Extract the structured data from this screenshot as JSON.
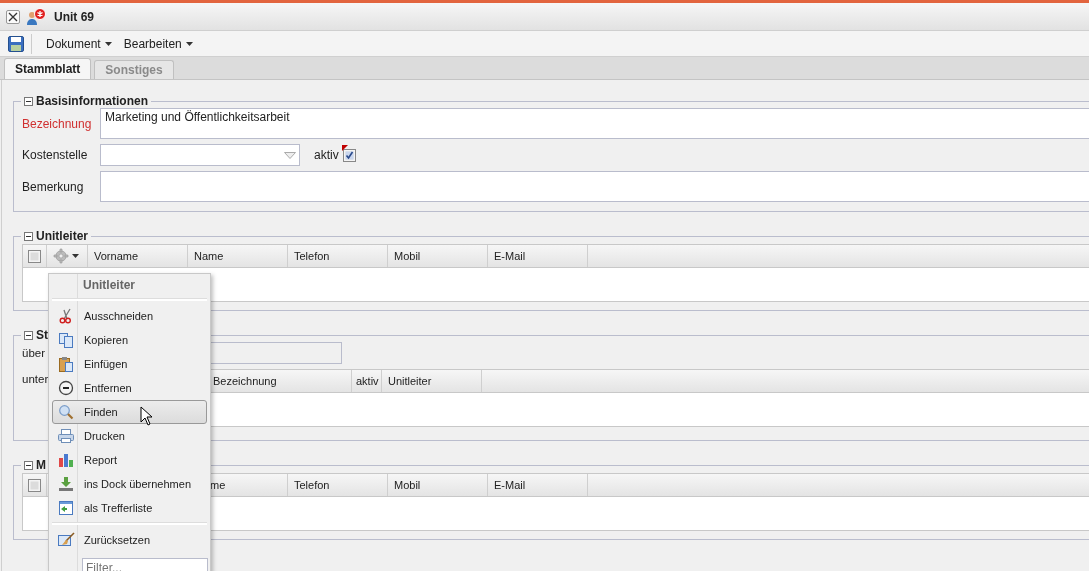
{
  "window": {
    "title": "Unit 69"
  },
  "toolbar": {
    "menus": [
      "Dokument",
      "Bearbeiten"
    ]
  },
  "tabs": [
    {
      "label": "Stammblatt",
      "selected": true
    },
    {
      "label": "Sonstiges",
      "selected": false
    }
  ],
  "basis": {
    "title": "Basisinformationen",
    "expanded": true,
    "bezeichnung": {
      "label": "Bezeichnung",
      "required": true,
      "value": "Marketing und Öffentlichkeitsarbeit"
    },
    "kostenstelle": {
      "label": "Kostenstelle"
    },
    "aktiv": {
      "label": "aktiv",
      "checked": true,
      "modified": true
    },
    "bemerkung": {
      "label": "Bemerkung"
    }
  },
  "unitleiter": {
    "title": "Unitleiter",
    "expanded": true,
    "select_all_checked": false,
    "columns": [
      "Vorname",
      "Name",
      "Telefon",
      "Mobil",
      "E-Mail"
    ]
  },
  "section_3": {
    "title": "St",
    "expanded": true,
    "field_label": "über",
    "grid_label": "unter",
    "columns": [
      "Bezeichnung",
      "aktiv",
      "Unitleiter"
    ]
  },
  "section_4": {
    "title": "M",
    "expanded": true,
    "select_all_checked": false,
    "columns": [
      "me",
      "Telefon",
      "Mobil",
      "E-Mail"
    ]
  },
  "context_menu": {
    "title": "Unitleiter",
    "groups": [
      [
        {
          "label": "Ausschneiden",
          "kind": "cut",
          "selected": false
        },
        {
          "label": "Kopieren",
          "kind": "copy",
          "selected": false
        },
        {
          "label": "Einfügen",
          "kind": "paste",
          "selected": false
        },
        {
          "label": "Entfernen",
          "kind": "remove",
          "selected": false
        },
        {
          "label": "Finden",
          "kind": "find",
          "selected": true
        },
        {
          "label": "Drucken",
          "kind": "print",
          "selected": false
        },
        {
          "label": "Report",
          "kind": "report",
          "selected": false
        },
        {
          "label": "ins Dock übernehmen",
          "kind": "dock",
          "selected": false
        },
        {
          "label": "als Trefferliste",
          "kind": "list",
          "selected": false
        }
      ],
      [
        {
          "label": "Zurücksetzen",
          "kind": "reset",
          "selected": false
        }
      ]
    ],
    "filter": {
      "placeholder": "Filter..."
    }
  }
}
